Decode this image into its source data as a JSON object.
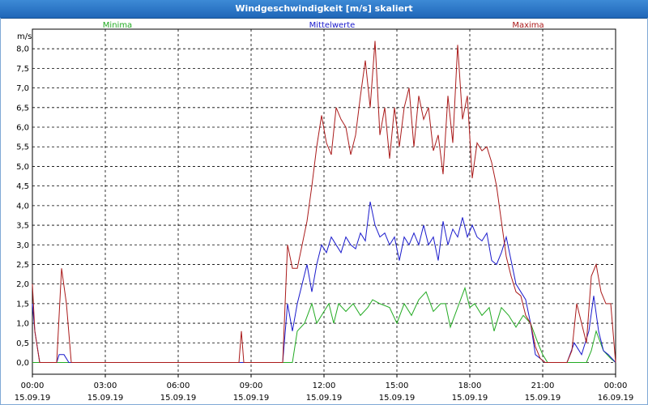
{
  "window": {
    "title": "Windgeschwindigkeit [m/s] skaliert"
  },
  "colors": {
    "min": "#22aa22",
    "avg": "#1a1acc",
    "max": "#aa1a1a"
  },
  "chart_data": {
    "type": "line",
    "title": "Windgeschwindigkeit [m/s] skaliert",
    "ylabel": "m/s",
    "ylim": [
      -0.3,
      8.5
    ],
    "yticks": [
      "0,0",
      "0,5",
      "1,0",
      "1,5",
      "2,0",
      "2,5",
      "3,0",
      "3,5",
      "4,0",
      "4,5",
      "5,0",
      "5,5",
      "6,0",
      "6,5",
      "7,0",
      "7,5",
      "8,0"
    ],
    "xlim_hours": [
      0,
      24
    ],
    "xticks": [
      {
        "time": "00:00",
        "date": "15.09.19"
      },
      {
        "time": "03:00",
        "date": "15.09.19"
      },
      {
        "time": "06:00",
        "date": "15.09.19"
      },
      {
        "time": "09:00",
        "date": "15.09.19"
      },
      {
        "time": "12:00",
        "date": "15.09.19"
      },
      {
        "time": "15:00",
        "date": "15.09.19"
      },
      {
        "time": "18:00",
        "date": "15.09.19"
      },
      {
        "time": "21:00",
        "date": "15.09.19"
      },
      {
        "time": "00:00",
        "date": "16.09.19"
      }
    ],
    "grid": true,
    "series": [
      {
        "name": "Minima",
        "color": "#22aa22",
        "x": [
          0,
          10.5,
          10.7,
          10.9,
          11.2,
          11.5,
          11.7,
          12.0,
          12.2,
          12.4,
          12.6,
          12.9,
          13.2,
          13.5,
          13.8,
          14.0,
          14.3,
          14.7,
          15.0,
          15.3,
          15.6,
          15.9,
          16.2,
          16.5,
          16.8,
          17.0,
          17.2,
          17.5,
          17.8,
          18.0,
          18.2,
          18.5,
          18.8,
          19.0,
          19.3,
          19.6,
          19.9,
          20.2,
          20.5,
          20.8,
          21.0,
          21.2,
          21.5,
          22.0,
          22.5,
          22.8,
          23.0,
          23.2,
          23.5,
          23.8,
          24.0
        ],
        "y": [
          0,
          0,
          0,
          0.8,
          1.0,
          1.5,
          1.0,
          1.3,
          1.5,
          1.0,
          1.5,
          1.3,
          1.5,
          1.2,
          1.4,
          1.6,
          1.5,
          1.4,
          1.0,
          1.5,
          1.2,
          1.6,
          1.8,
          1.3,
          1.5,
          1.5,
          0.9,
          1.4,
          1.9,
          1.4,
          1.5,
          1.2,
          1.4,
          0.8,
          1.4,
          1.2,
          0.9,
          1.2,
          1.0,
          0.5,
          0.2,
          0,
          0,
          0,
          0,
          0,
          0.3,
          0.8,
          0.3,
          0.1,
          0
        ]
      },
      {
        "name": "Mittelwerte",
        "color": "#1a1acc",
        "x": [
          0,
          0.1,
          0.3,
          1.0,
          1.1,
          1.3,
          1.5,
          10.3,
          10.5,
          10.7,
          10.9,
          11.1,
          11.3,
          11.5,
          11.7,
          11.9,
          12.1,
          12.3,
          12.5,
          12.7,
          12.9,
          13.1,
          13.3,
          13.5,
          13.7,
          13.9,
          14.1,
          14.3,
          14.5,
          14.7,
          14.9,
          15.1,
          15.3,
          15.5,
          15.7,
          15.9,
          16.1,
          16.3,
          16.5,
          16.7,
          16.9,
          17.1,
          17.3,
          17.5,
          17.7,
          17.9,
          18.1,
          18.3,
          18.5,
          18.7,
          18.9,
          19.1,
          19.3,
          19.5,
          19.7,
          19.9,
          20.1,
          20.3,
          20.5,
          20.7,
          20.9,
          21.1,
          21.3,
          21.5,
          22.0,
          22.3,
          22.6,
          22.9,
          23.1,
          23.3,
          23.5,
          23.7,
          24.0
        ],
        "y": [
          1.5,
          0.8,
          0,
          0,
          0.2,
          0.2,
          0,
          0,
          1.5,
          0.8,
          1.5,
          2.0,
          2.5,
          1.8,
          2.5,
          3.0,
          2.8,
          3.2,
          3.0,
          2.8,
          3.2,
          3.0,
          2.9,
          3.3,
          3.1,
          4.1,
          3.5,
          3.2,
          3.3,
          3.0,
          3.2,
          2.6,
          3.2,
          3.0,
          3.3,
          3.0,
          3.5,
          3.0,
          3.2,
          2.6,
          3.6,
          3.0,
          3.4,
          3.2,
          3.7,
          3.2,
          3.5,
          3.2,
          3.1,
          3.3,
          2.6,
          2.5,
          2.8,
          3.2,
          2.6,
          2.0,
          1.8,
          1.6,
          1.0,
          0.2,
          0.1,
          0,
          0,
          0,
          0,
          0.5,
          0.2,
          0.8,
          1.7,
          0.8,
          0.3,
          0.2,
          0
        ]
      },
      {
        "name": "Maxima",
        "color": "#aa1a1a",
        "x": [
          0,
          0.1,
          0.3,
          1.0,
          1.2,
          1.4,
          1.6,
          8.5,
          8.6,
          8.7,
          10.3,
          10.5,
          10.7,
          10.9,
          11.1,
          11.3,
          11.5,
          11.7,
          11.9,
          12.1,
          12.3,
          12.5,
          12.7,
          12.9,
          13.1,
          13.3,
          13.5,
          13.7,
          13.9,
          14.1,
          14.3,
          14.5,
          14.7,
          14.9,
          15.1,
          15.3,
          15.5,
          15.7,
          15.9,
          16.1,
          16.3,
          16.5,
          16.7,
          16.9,
          17.1,
          17.3,
          17.5,
          17.7,
          17.9,
          18.1,
          18.3,
          18.5,
          18.7,
          18.9,
          19.1,
          19.3,
          19.5,
          19.7,
          19.9,
          20.1,
          20.3,
          20.5,
          20.7,
          20.9,
          21.1,
          21.3,
          21.5,
          22.0,
          22.2,
          22.4,
          22.6,
          22.8,
          23.0,
          23.2,
          23.4,
          23.6,
          23.8,
          24.0
        ],
        "y": [
          2.0,
          0.8,
          0,
          0,
          2.4,
          1.5,
          0,
          0,
          0.8,
          0,
          0,
          3.0,
          2.4,
          2.4,
          3.0,
          3.6,
          4.5,
          5.5,
          6.3,
          5.6,
          5.3,
          6.5,
          6.2,
          6.0,
          5.3,
          5.8,
          6.8,
          7.7,
          6.5,
          8.2,
          5.8,
          6.5,
          5.2,
          6.5,
          5.5,
          6.5,
          7.0,
          5.5,
          6.8,
          6.2,
          6.5,
          5.4,
          5.8,
          4.8,
          6.8,
          5.6,
          8.1,
          6.2,
          6.8,
          4.7,
          5.6,
          5.4,
          5.5,
          5.1,
          4.5,
          3.6,
          2.7,
          2.2,
          1.8,
          1.7,
          1.2,
          1.0,
          0.4,
          0.1,
          0,
          0,
          0,
          0,
          0.3,
          1.5,
          1.0,
          0.5,
          2.2,
          2.5,
          1.8,
          1.5,
          1.5,
          0
        ]
      }
    ]
  }
}
